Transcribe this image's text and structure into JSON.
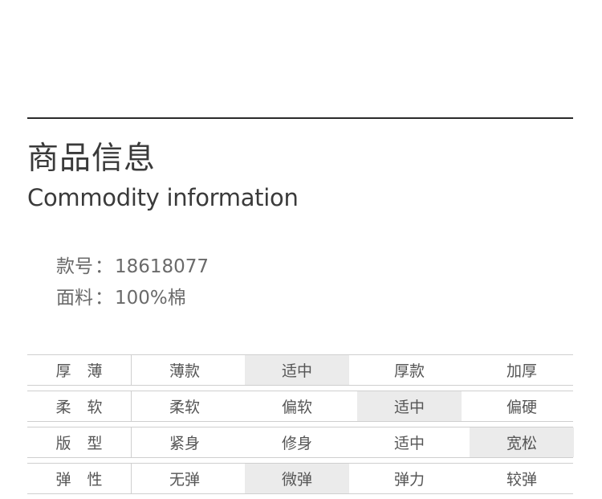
{
  "header": {
    "title_zh": "商品信息",
    "title_en": "Commodity information"
  },
  "info": {
    "style_label": "款号",
    "style_value": "18618077",
    "fabric_label": "面料",
    "fabric_value": "100%棉",
    "separator": "："
  },
  "attributes": [
    {
      "label": "厚薄",
      "options": [
        "薄款",
        "适中",
        "厚款",
        "加厚"
      ],
      "selected": 1
    },
    {
      "label": "柔软",
      "options": [
        "柔软",
        "偏软",
        "适中",
        "偏硬"
      ],
      "selected": 2
    },
    {
      "label": "版型",
      "options": [
        "紧身",
        "修身",
        "适中",
        "宽松"
      ],
      "selected": 3
    },
    {
      "label": "弹性",
      "options": [
        "无弹",
        "微弹",
        "弹力",
        "较弹"
      ],
      "selected": 1
    }
  ],
  "colors": {
    "rule": "#2b2b2b",
    "highlight": "#ebebeb",
    "border": "#cfcfcf"
  }
}
